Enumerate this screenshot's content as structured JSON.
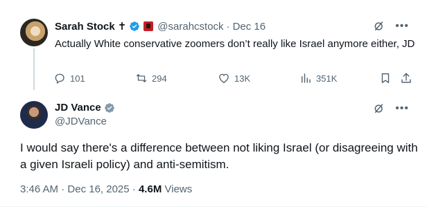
{
  "reply_tweet": {
    "author_name": "Sarah Stock",
    "author_symbol": "✝",
    "handle": "@sarahcstock",
    "date": "Dec 16",
    "text": "Actually White conservative zoomers don’t really like Israel anymore either, JD",
    "stats": {
      "replies": "101",
      "retweets": "294",
      "likes": "13K",
      "views": "351K"
    }
  },
  "main_tweet": {
    "author_name": "JD Vance",
    "handle": "@JDVance",
    "text": "I would say there's a difference between not liking Israel (or disagreeing with a given Israeli policy) and anti-semitism.",
    "time": "3:46 AM",
    "date": "Dec 16, 2025",
    "views_count": "4.6M",
    "views_label": "Views"
  },
  "icons": {
    "reply": "reply-icon",
    "retweet": "retweet-icon",
    "like": "heart-icon",
    "views": "views-icon",
    "bookmark": "bookmark-icon",
    "share": "share-icon",
    "grok": "grok-icon",
    "more": "more-icon"
  },
  "colors": {
    "verified_blue": "#1d9bf0",
    "government_gray": "#829aab",
    "secondary_text": "#536471",
    "primary_text": "#0f1419"
  },
  "separators": {
    "dot": "·"
  }
}
